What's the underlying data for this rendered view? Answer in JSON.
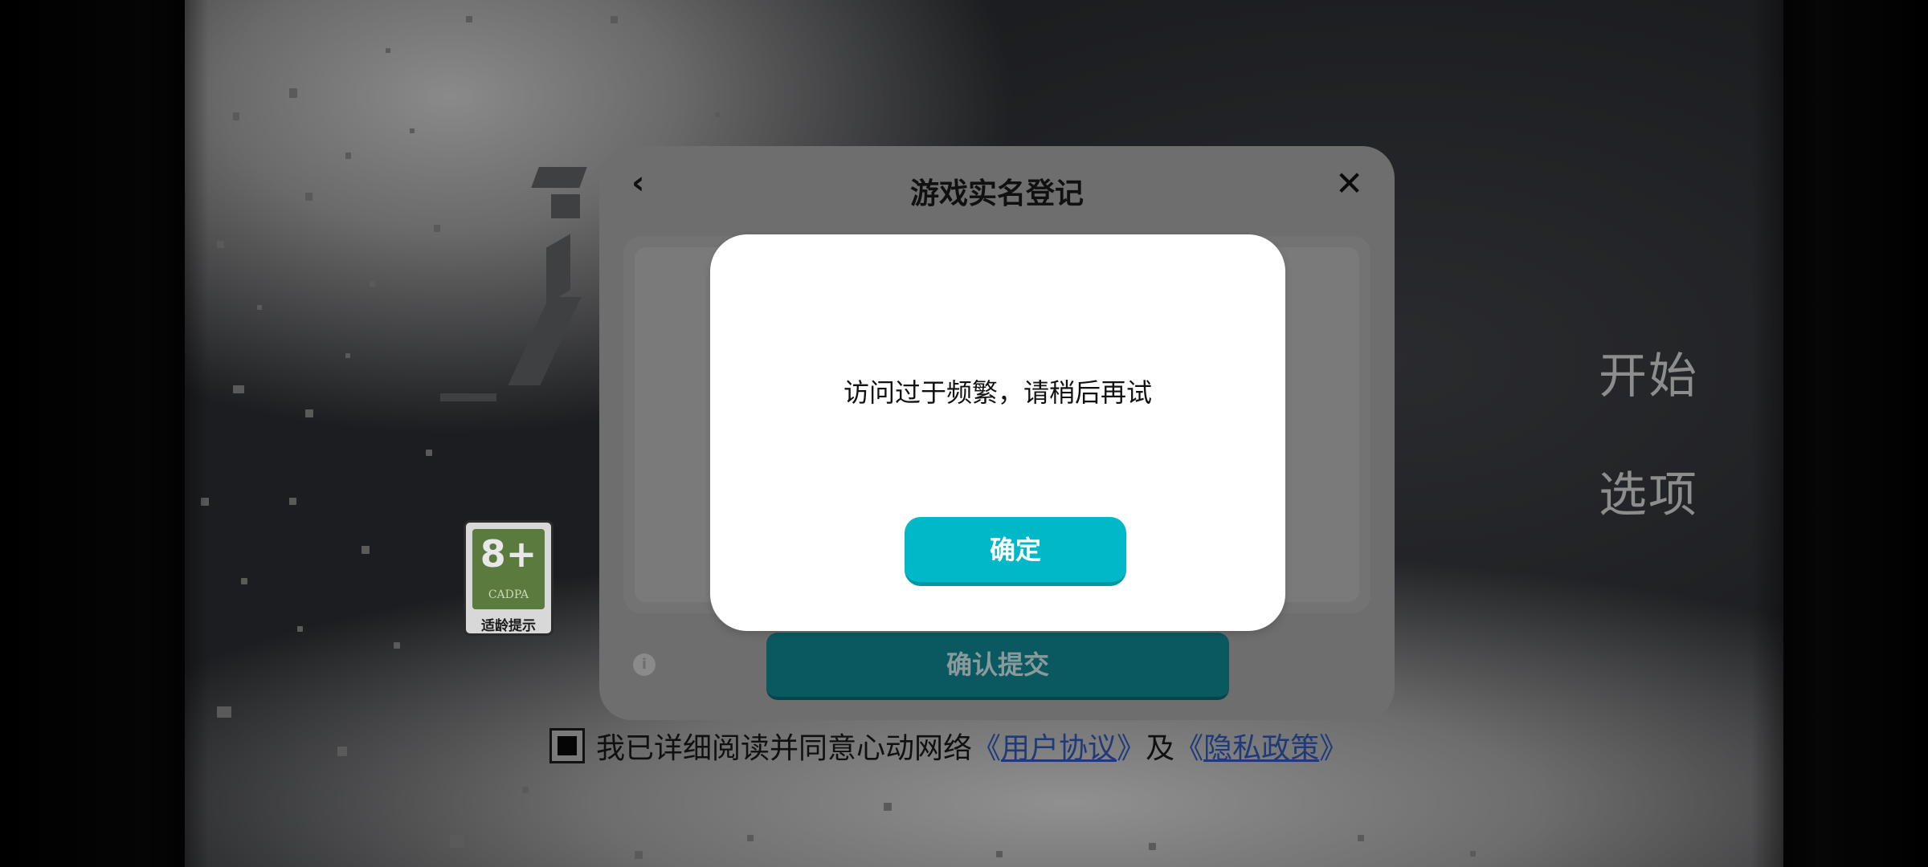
{
  "game_menu": {
    "start_label": "开始",
    "options_label": "选项"
  },
  "age_rating": {
    "age": "8+",
    "org": "CADPA",
    "hint": "适龄提示"
  },
  "registration": {
    "title": "游戏实名登记",
    "back_icon": "chevron-left-icon",
    "close_icon": "close-icon",
    "submit_label": "确认提交"
  },
  "agreement": {
    "prefix": "我已详细阅读并同意心动网络",
    "open_quote_1": "《",
    "user_agreement": "用户协议",
    "close_quote_1": "》",
    "conjunction": "及",
    "open_quote_2": "《",
    "privacy_policy": "隐私政策",
    "close_quote_2": "》",
    "checked": true
  },
  "alert": {
    "message": "访问过于频繁，请稍后再试",
    "confirm_label": "确定",
    "accent_color": "#00b8c8"
  }
}
